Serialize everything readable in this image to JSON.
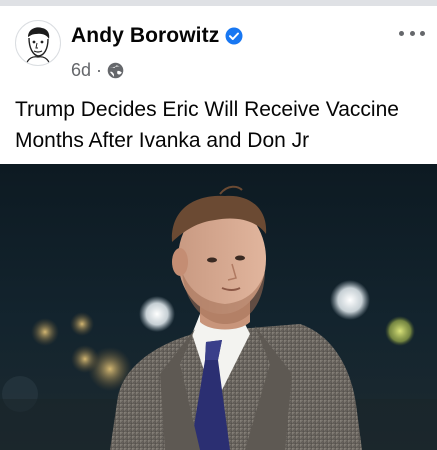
{
  "post": {
    "author": "Andy Borowitz",
    "verified_badge": "verified-check-icon",
    "time": "6d",
    "separator": "·",
    "audience_icon": "globe-icon",
    "text": "Trump Decides Eric Will Receive Vaccine Months After Ivanka and Don Jr",
    "more_icon": "more-options-icon"
  },
  "colors": {
    "verified_blue": "#1877f2",
    "meta_gray": "#65676b",
    "text": "#050505"
  }
}
